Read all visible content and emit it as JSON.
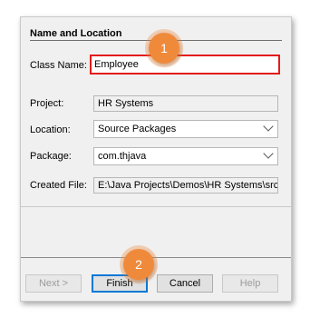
{
  "section": {
    "title": "Name and Location"
  },
  "fields": {
    "class_name": {
      "label": "Class Name:",
      "value": "Employee"
    },
    "project": {
      "label": "Project:",
      "value": "HR Systems"
    },
    "location": {
      "label": "Location:",
      "value": "Source Packages"
    },
    "package": {
      "label": "Package:",
      "value": "com.thjava"
    },
    "created_file": {
      "label": "Created File:",
      "value": "E:\\Java Projects\\Demos\\HR Systems\\src\\"
    }
  },
  "buttons": {
    "next": "Next >",
    "finish": "Finish",
    "cancel": "Cancel",
    "help": "Help"
  },
  "annotations": {
    "step1": "1",
    "step2": "2"
  },
  "colors": {
    "highlight": "#e31b1b",
    "badge": "#f08a3b",
    "default_button_border": "#0078d7"
  }
}
